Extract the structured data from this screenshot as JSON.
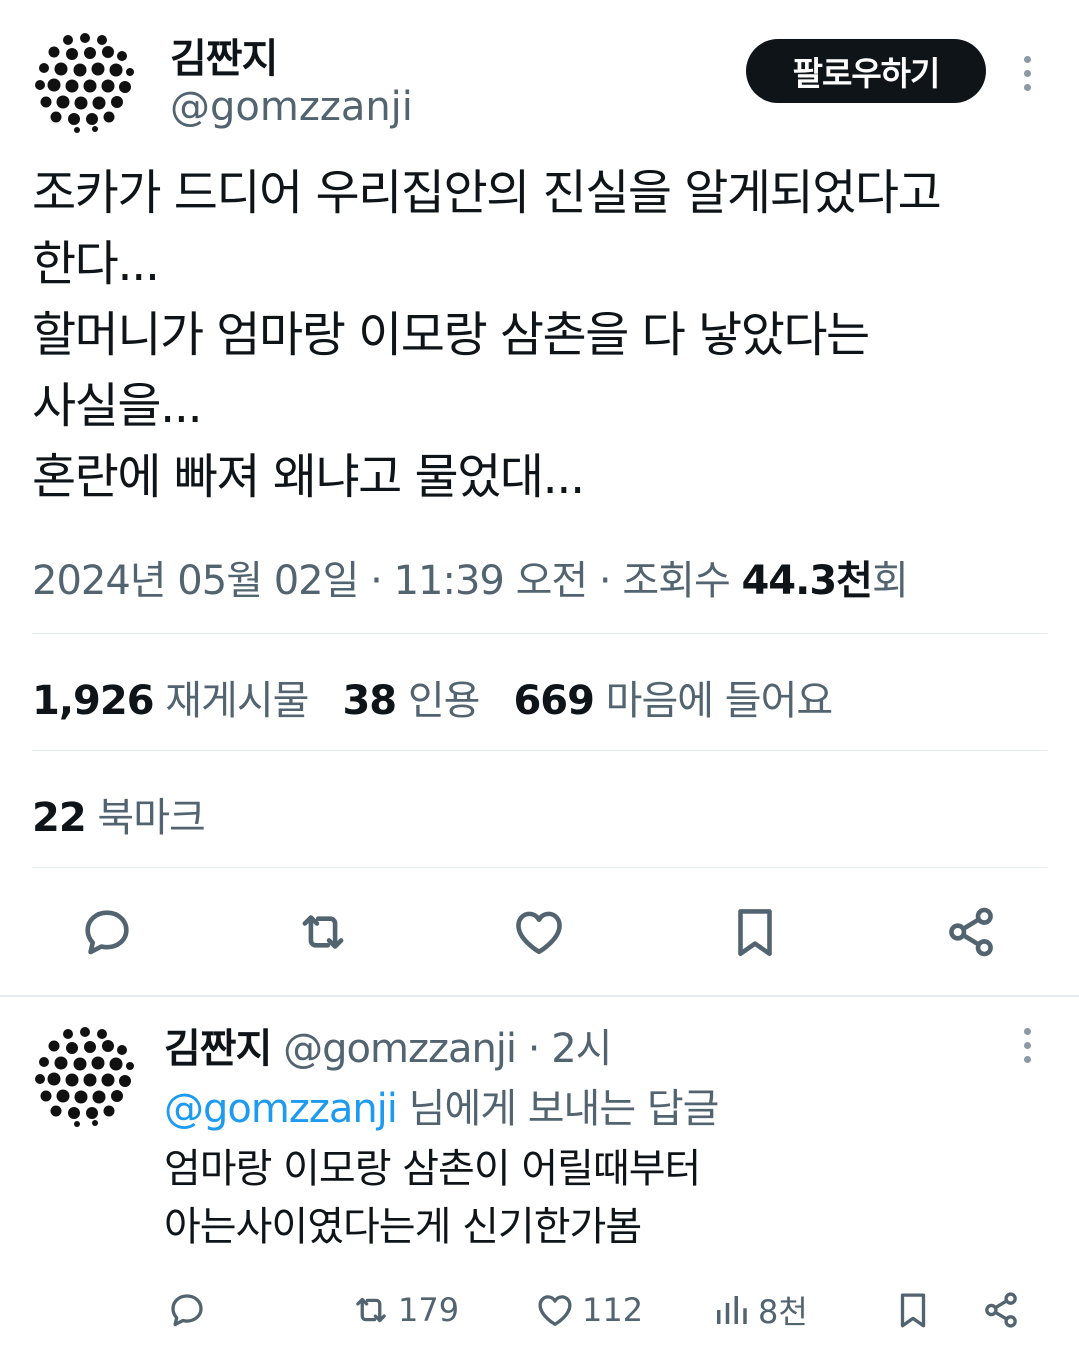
{
  "tweet": {
    "author_name": "김짠지",
    "author_handle": "@gomzzanji",
    "follow_label": "팔로우하기",
    "text_lines": [
      "조카가 드디어 우리집안의 진실을 알게되었다고",
      "한다...",
      "할머니가 엄마랑 이모랑 삼촌을 다 낳았다는",
      "사실을...",
      "혼란에 빠져 왜냐고 물었대..."
    ],
    "date": "2024년 05월 02일",
    "time": "11:39 오전",
    "views_label": "조회수",
    "views_value": "44.3천",
    "views_suffix": "회",
    "separator": "·",
    "stats": {
      "retweets_value": "1,926",
      "retweets_label": "재게시물",
      "quotes_value": "38",
      "quotes_label": "인용",
      "likes_value": "669",
      "likes_label": "마음에 들어요",
      "bookmarks_value": "22",
      "bookmarks_label": "북마크"
    },
    "action_icons": [
      "reply-icon",
      "retweet-icon",
      "like-icon",
      "bookmark-icon",
      "share-icon"
    ]
  },
  "reply": {
    "author_name": "김짠지",
    "author_handle": "@gomzzanji",
    "separator": "·",
    "time_ago": "2시",
    "reply_to_mention": "@gomzzanji",
    "reply_to_suffix": "님에게 보내는 답글",
    "text_lines": [
      "엄마랑 이모랑 삼촌이 어릴때부터",
      "아는사이였다는게 신기한가봄"
    ],
    "retweets": "179",
    "likes": "112",
    "views": "8천"
  },
  "colors": {
    "text": "#0f1419",
    "secondary": "#536471",
    "link": "#1d9bf0",
    "divider": "#e6ebee",
    "button_bg": "#0f1419"
  }
}
